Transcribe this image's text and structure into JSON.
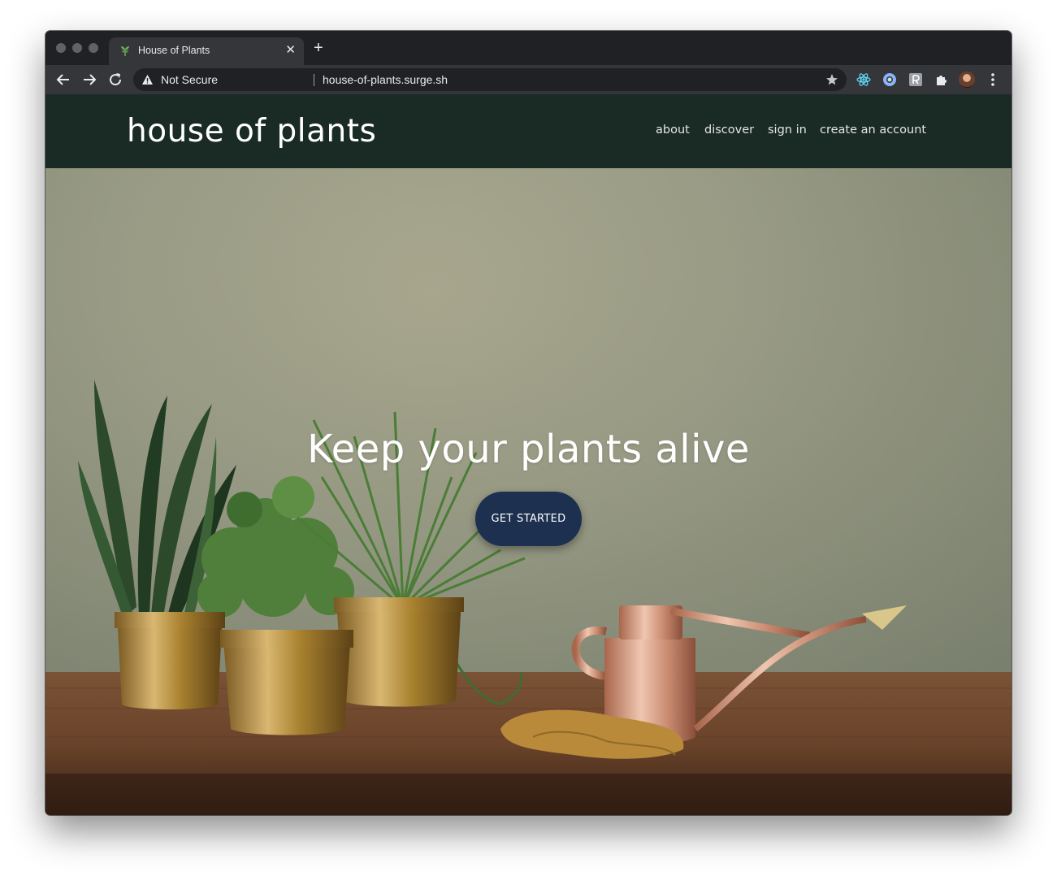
{
  "browser": {
    "tab": {
      "title": "House of Plants",
      "favicon": "plant-favicon-icon"
    },
    "address_bar": {
      "security_label": "Not Secure",
      "url": "house-of-plants.surge.sh"
    },
    "extensions": [
      "react-devtools-icon",
      "ring-extension-icon",
      "r-extension-icon",
      "puzzle-extensions-icon"
    ]
  },
  "site": {
    "brand": "house of plants",
    "nav": [
      "about",
      "discover",
      "sign in",
      "create an account"
    ],
    "header_bg": "#1a2a24"
  },
  "hero": {
    "headline": "Keep your plants alive",
    "cta_label": "GET STARTED",
    "cta_bg": "#1d3050"
  }
}
